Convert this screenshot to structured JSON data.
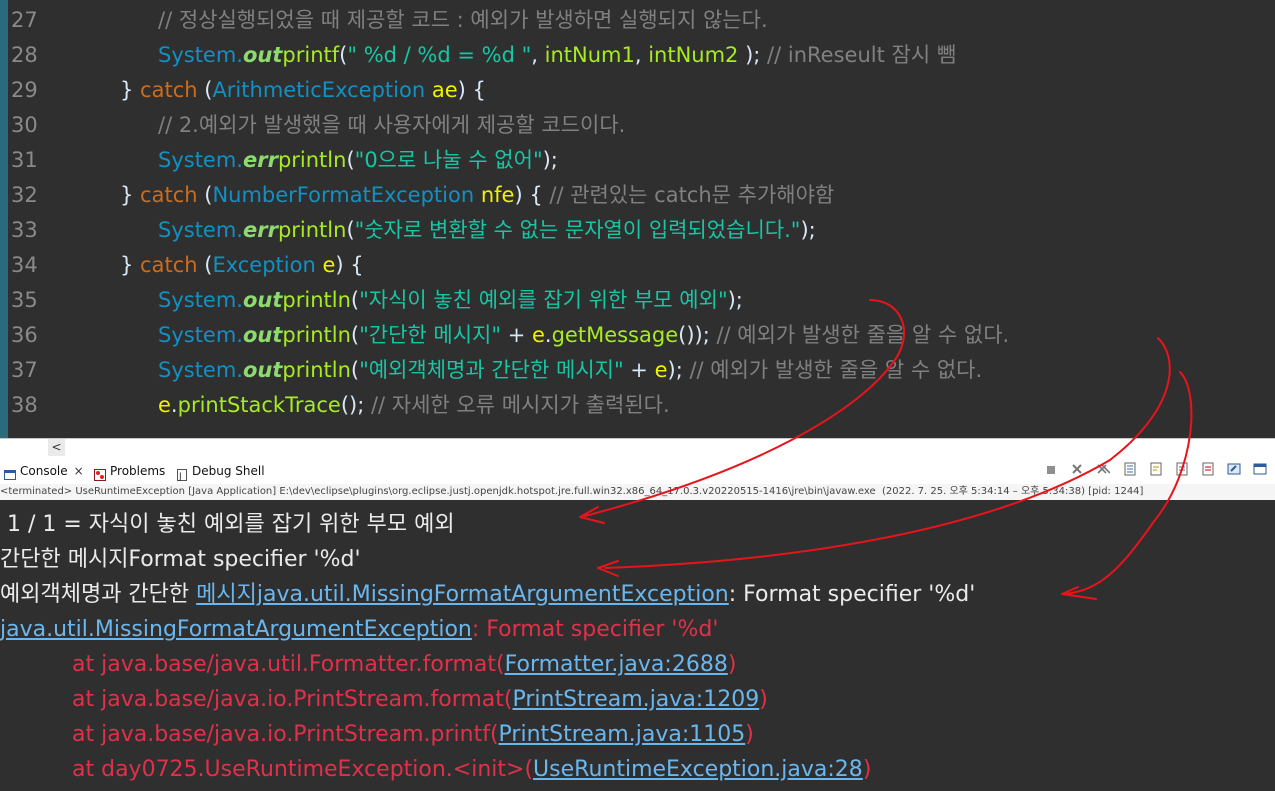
{
  "editor": {
    "lines": [
      {
        "num": "27",
        "indent": 158,
        "parts": [
          [
            "cm",
            "// 정상실행되었을 때 제공할 코드 : 예외가 발생하면 실행되지 않는다."
          ]
        ]
      },
      {
        "num": "28",
        "indent": 158,
        "parts": [
          [
            "ty",
            "System."
          ],
          [
            "fld",
            "out"
          ],
          [
            "mth",
            "printf"
          ],
          [
            "txt",
            "("
          ],
          [
            "str",
            "\" %d / %d = %d \""
          ],
          [
            "txt",
            ", "
          ],
          [
            "mth",
            "intNum1"
          ],
          [
            "txt",
            ", "
          ],
          [
            "mth",
            "intNum2"
          ],
          [
            "txt",
            " ); "
          ],
          [
            "cm",
            "// inReseult 잠시 뺌"
          ]
        ]
      },
      {
        "num": "29",
        "indent": 120,
        "parts": [
          [
            "txt",
            "} "
          ],
          [
            "kw",
            "catch"
          ],
          [
            "txt",
            " ("
          ],
          [
            "ty",
            "ArithmeticException"
          ],
          [
            "txt",
            " "
          ],
          [
            "var",
            "ae"
          ],
          [
            "txt",
            ") {"
          ]
        ]
      },
      {
        "num": "30",
        "indent": 158,
        "parts": [
          [
            "cm",
            "// 2.예외가 발생했을 때 사용자에게 제공할 코드이다."
          ]
        ]
      },
      {
        "num": "31",
        "indent": 158,
        "parts": [
          [
            "ty",
            "System."
          ],
          [
            "fld",
            "err"
          ],
          [
            "mth",
            "println"
          ],
          [
            "txt",
            "("
          ],
          [
            "str",
            "\"0으로 나눌 수 없어\""
          ],
          [
            "txt",
            ");"
          ]
        ]
      },
      {
        "num": "32",
        "indent": 120,
        "parts": [
          [
            "txt",
            "} "
          ],
          [
            "kw",
            "catch"
          ],
          [
            "txt",
            " ("
          ],
          [
            "ty",
            "NumberFormatException"
          ],
          [
            "txt",
            " "
          ],
          [
            "var",
            "nfe"
          ],
          [
            "txt",
            ") { "
          ],
          [
            "cm",
            "// 관련있는 catch문 추가해야함"
          ]
        ]
      },
      {
        "num": "33",
        "indent": 158,
        "parts": [
          [
            "ty",
            "System."
          ],
          [
            "fld",
            "err"
          ],
          [
            "mth",
            "println"
          ],
          [
            "txt",
            "("
          ],
          [
            "str",
            "\"숫자로 변환할 수 없는 문자열이 입력되었습니다.\""
          ],
          [
            "txt",
            ");"
          ]
        ]
      },
      {
        "num": "34",
        "indent": 120,
        "parts": [
          [
            "txt",
            "} "
          ],
          [
            "kw",
            "catch"
          ],
          [
            "txt",
            " ("
          ],
          [
            "ty",
            "Exception"
          ],
          [
            "txt",
            " "
          ],
          [
            "var",
            "e"
          ],
          [
            "txt",
            ") {"
          ]
        ]
      },
      {
        "num": "35",
        "indent": 158,
        "parts": [
          [
            "ty",
            "System."
          ],
          [
            "fld",
            "out"
          ],
          [
            "mth",
            "println"
          ],
          [
            "txt",
            "("
          ],
          [
            "str",
            "\"자식이 놓친 예외를 잡기 위한 부모 예외\""
          ],
          [
            "txt",
            ");"
          ]
        ]
      },
      {
        "num": "36",
        "indent": 158,
        "parts": [
          [
            "ty",
            "System."
          ],
          [
            "fld",
            "out"
          ],
          [
            "mth",
            "println"
          ],
          [
            "txt",
            "("
          ],
          [
            "str",
            "\"간단한 메시지\""
          ],
          [
            "txt",
            " + "
          ],
          [
            "var",
            "e"
          ],
          [
            "txt",
            "."
          ],
          [
            "mth",
            "getMessage"
          ],
          [
            "txt",
            "()); "
          ],
          [
            "cm",
            "// 예외가 발생한 줄을 알 수 없다."
          ]
        ]
      },
      {
        "num": "37",
        "indent": 158,
        "parts": [
          [
            "ty",
            "System."
          ],
          [
            "fld",
            "out"
          ],
          [
            "mth",
            "println"
          ],
          [
            "txt",
            "("
          ],
          [
            "str",
            "\"예외객체명과 간단한 메시지\""
          ],
          [
            "txt",
            " + "
          ],
          [
            "var",
            "e"
          ],
          [
            "txt",
            "); "
          ],
          [
            "cm",
            "// 예외가 발생한 줄을 알 수 없다."
          ]
        ]
      },
      {
        "num": "38",
        "indent": 158,
        "parts": [
          [
            "var",
            "e"
          ],
          [
            "txt",
            "."
          ],
          [
            "mth",
            "printStackTrace"
          ],
          [
            "txt",
            "(); "
          ],
          [
            "cm",
            "// 자세한 오류 메시지가 출력된다."
          ]
        ]
      }
    ]
  },
  "scrollbar": {
    "left_arrow": "<"
  },
  "views": {
    "tabs": [
      {
        "label": "Console",
        "icon": "console-icon"
      },
      {
        "label": "Problems",
        "icon": "problems-icon"
      },
      {
        "label": "Debug Shell",
        "icon": "debug-shell-icon"
      }
    ],
    "close_glyph": "×",
    "toolbar_icons": [
      "terminate-icon",
      "remove-launch-icon",
      "remove-all-icon",
      "scroll-lock-icon",
      "word-wrap-icon",
      "show-stdout-icon",
      "show-stderr-icon",
      "pin-console-icon",
      "display-console-icon"
    ]
  },
  "termination": "<terminated> UseRuntimeException [Java Application] E:\\dev\\eclipse\\plugins\\org.eclipse.justj.openjdk.hotspot.jre.full.win32.x86_64_17.0.3.v20220515-1416\\jre\\bin\\javaw.exe  (2022. 7. 25. 오후 5:34:14 – 오후 5:34:38) [pid: 1244]",
  "console": {
    "lines": [
      {
        "indent": 0,
        "parts": [
          [
            "out",
            " 1 / 1 = 자식이 놓친 예외를 잡기 위한 부모 예외"
          ]
        ]
      },
      {
        "indent": 0,
        "parts": [
          [
            "out",
            "간단한 메시지Format specifier '%d'"
          ]
        ]
      },
      {
        "indent": 0,
        "parts": [
          [
            "out",
            "예외객체명과 간단한 "
          ],
          [
            "lnk",
            "메시지java.util.MissingFormatArgumentException"
          ],
          [
            "out",
            ": Format specifier '%d'"
          ]
        ]
      },
      {
        "indent": 0,
        "parts": [
          [
            "lnk",
            "java.util.MissingFormatArgumentException"
          ],
          [
            "err",
            ": Format specifier '%d'"
          ]
        ]
      },
      {
        "indent": 72,
        "parts": [
          [
            "err",
            "at java.base/java.util.Formatter.format("
          ],
          [
            "lnk",
            "Formatter.java:2688"
          ],
          [
            "err",
            ")"
          ]
        ]
      },
      {
        "indent": 72,
        "parts": [
          [
            "err",
            "at java.base/java.io.PrintStream.format("
          ],
          [
            "lnk",
            "PrintStream.java:1209"
          ],
          [
            "err",
            ")"
          ]
        ]
      },
      {
        "indent": 72,
        "parts": [
          [
            "err",
            "at java.base/java.io.PrintStream.printf("
          ],
          [
            "lnk",
            "PrintStream.java:1105"
          ],
          [
            "err",
            ")"
          ]
        ]
      },
      {
        "indent": 72,
        "parts": [
          [
            "err",
            "at day0725.UseRuntimeException.<init>("
          ],
          [
            "lnk",
            "UseRuntimeException.java:28"
          ],
          [
            "err",
            ")"
          ]
        ]
      }
    ]
  },
  "colors": {
    "annotation": "#e8141c",
    "background": "#2f2f2f"
  }
}
